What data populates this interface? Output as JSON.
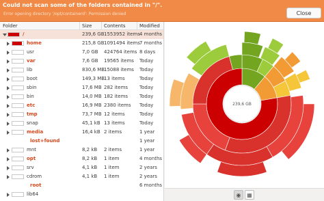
{
  "infobar": {
    "title": "Could not scan some of the folders contained in \"/\".",
    "detail": "Error opening directory '/opt/containerd': Permission denied",
    "close_label": "Close"
  },
  "tree": {
    "headers": {
      "folder": "Folder",
      "size": "Size",
      "contents": "Contents",
      "modified": "Modified"
    },
    "rows": [
      {
        "name": "/",
        "size": "239,6 GB",
        "contents": "1553952 items",
        "modified": "4 months",
        "fill": 1.0,
        "color": "#cc0000",
        "expanded": true,
        "highlight": true,
        "indent": 0
      },
      {
        "name": "home",
        "size": "215,8 GB",
        "contents": "1091494 items",
        "modified": "7 months",
        "fill": 0.9,
        "color": "#cc0000",
        "expanded": false,
        "highlight": true,
        "indent": 1
      },
      {
        "name": "usr",
        "size": "7,0 GB",
        "contents": "424764 items",
        "modified": "8 days",
        "fill": 0.0,
        "color": "#cc0000",
        "expanded": false,
        "highlight": false,
        "indent": 1
      },
      {
        "name": "var",
        "size": "7,6 GB",
        "contents": "19565 items",
        "modified": "Today",
        "fill": 0.0,
        "color": "#cc0000",
        "expanded": false,
        "highlight": true,
        "indent": 1
      },
      {
        "name": "lib",
        "size": "830,6 MB",
        "contents": "15088 items",
        "modified": "Today",
        "fill": 0.0,
        "color": "#cc0000",
        "expanded": false,
        "highlight": false,
        "indent": 1
      },
      {
        "name": "boot",
        "size": "149,3 MB",
        "contents": "13 items",
        "modified": "Today",
        "fill": 0.0,
        "color": "#cc0000",
        "expanded": false,
        "highlight": false,
        "indent": 1
      },
      {
        "name": "sbin",
        "size": "17,6 MB",
        "contents": "282 items",
        "modified": "Today",
        "fill": 0.0,
        "color": "#cc0000",
        "expanded": false,
        "highlight": false,
        "indent": 1
      },
      {
        "name": "bin",
        "size": "14,0 MB",
        "contents": "182 items",
        "modified": "Today",
        "fill": 0.0,
        "color": "#cc0000",
        "expanded": false,
        "highlight": false,
        "indent": 1
      },
      {
        "name": "etc",
        "size": "16,9 MB",
        "contents": "2380 items",
        "modified": "Today",
        "fill": 0.0,
        "color": "#cc0000",
        "expanded": false,
        "highlight": true,
        "indent": 1
      },
      {
        "name": "tmp",
        "size": "73,7 MB",
        "contents": "12 items",
        "modified": "Today",
        "fill": 0.0,
        "color": "#cc0000",
        "expanded": false,
        "highlight": true,
        "indent": 1
      },
      {
        "name": "snap",
        "size": "45,1 kB",
        "contents": "13 items",
        "modified": "Today",
        "fill": 0.0,
        "color": "#cc0000",
        "expanded": false,
        "highlight": false,
        "indent": 1
      },
      {
        "name": "media",
        "size": "16,4 kB",
        "contents": "2 items",
        "modified": "1 year",
        "fill": 0.0,
        "color": "#cc0000",
        "expanded": false,
        "highlight": true,
        "indent": 1
      },
      {
        "name": "lost+found",
        "size": "",
        "contents": "",
        "modified": "1 year",
        "fill": 0.0,
        "color": "#cc0000",
        "expanded": false,
        "highlight": true,
        "indent": 1,
        "no_toggle": true
      },
      {
        "name": "mnt",
        "size": "8,2 kB",
        "contents": "2 items",
        "modified": "1 year",
        "fill": 0.0,
        "color": "#cc0000",
        "expanded": false,
        "highlight": false,
        "indent": 1
      },
      {
        "name": "opt",
        "size": "8,2 kB",
        "contents": "1 item",
        "modified": "4 months",
        "fill": 0.0,
        "color": "#cc0000",
        "expanded": false,
        "highlight": true,
        "indent": 1
      },
      {
        "name": "srv",
        "size": "4,1 kB",
        "contents": "1 item",
        "modified": "2 years",
        "fill": 0.0,
        "color": "#cc0000",
        "expanded": false,
        "highlight": false,
        "indent": 1
      },
      {
        "name": "cdrom",
        "size": "4,1 kB",
        "contents": "1 item",
        "modified": "2 years",
        "fill": 0.0,
        "color": "#cc0000",
        "expanded": false,
        "highlight": false,
        "indent": 1
      },
      {
        "name": "root",
        "size": "",
        "contents": "",
        "modified": "6 months",
        "fill": 0.0,
        "color": "#cc0000",
        "expanded": false,
        "highlight": true,
        "indent": 1,
        "no_toggle": true
      },
      {
        "name": "lib64",
        "size": "",
        "contents": "",
        "modified": "",
        "fill": 0.0,
        "color": "#cc0000",
        "expanded": false,
        "highlight": false,
        "indent": 1
      }
    ]
  },
  "chart": {
    "center_label": "239,6 GB",
    "colors": {
      "root": "#cc0000",
      "red_light": "#e8423c",
      "red_mid": "#d9312b",
      "green": "#73a520",
      "green_light": "#9ccc3c",
      "orange": "#f29a34",
      "yellow": "#f5c53a",
      "orange_light": "#f7b76b"
    }
  },
  "bottom": {
    "ring_icon": "ring-chart-icon",
    "treemap_icon": "treemap-icon"
  }
}
